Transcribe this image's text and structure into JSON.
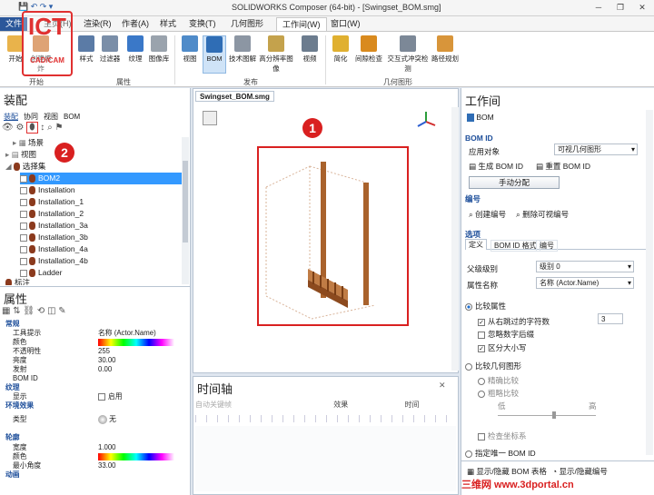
{
  "window": {
    "title": "SOLIDWORKS Composer (64-bit) - [Swingset_BOM.smg]"
  },
  "tabs": [
    "文件",
    "主页(H)",
    "渲染(R)",
    "作者(A)",
    "样式",
    "变换(T)",
    "几何图形",
    "工作间(W)",
    "窗口(W)"
  ],
  "ribbon": {
    "buttons": [
      "开始",
      "创建爆炸",
      "样式",
      "过滤器",
      "纹理",
      "图像库",
      "视图",
      "BOM",
      "技术图解",
      "高分辨率图像",
      "视频",
      "简化",
      "间隙检查",
      "交互式冲突检测",
      "路径规划"
    ],
    "groups": [
      "开始",
      "属性",
      "发布",
      "几何图形"
    ]
  },
  "watermark": {
    "line1": "ICT",
    "line2": "CAD/CAM"
  },
  "left_panel": {
    "title": "装配",
    "subtabs": [
      "装配",
      "协同",
      "视图",
      "BOM"
    ],
    "tree": [
      "场景",
      "视图",
      "选择集",
      "BOM2",
      "Installation",
      "Installation_1",
      "Installation_2",
      "Installation_3a",
      "Installation_3b",
      "Installation_4a",
      "Installation_4b",
      "Ladder",
      "标注"
    ]
  },
  "props": {
    "title": "属性",
    "sections": [
      "常规",
      "纹理",
      "环境效果",
      "轮廓"
    ],
    "rows": [
      {
        "k": "工具提示",
        "v": "名称 (Actor.Name)"
      },
      {
        "k": "颜色",
        "v": ""
      },
      {
        "k": "不透明性",
        "v": "255"
      },
      {
        "k": "亮度",
        "v": "30.00"
      },
      {
        "k": "发射",
        "v": "0.00"
      },
      {
        "k": "BOM ID",
        "v": ""
      },
      {
        "k": "显示",
        "v": "启用"
      },
      {
        "k": "类型",
        "v": "无"
      },
      {
        "k": "宽度",
        "v": "1.000"
      },
      {
        "k": "颜色",
        "v": ""
      },
      {
        "k": "最小角度",
        "v": "33.00"
      },
      {
        "k": "动画",
        "v": ""
      }
    ]
  },
  "viewport": {
    "tab": "Swingset_BOM.smg",
    "marker1": "1",
    "marker2": "2"
  },
  "timeline": {
    "title": "时间轴",
    "toolbar": [
      "自动关键帧",
      "效果",
      "时间"
    ]
  },
  "workspace": {
    "title": "工作间",
    "bom_label": "BOM",
    "bom_id_section": "BOM ID",
    "apply_to_label": "应用对象",
    "apply_to_value": "可视几何图形",
    "gen_bom_id": "生成 BOM ID",
    "reset_bom_id": "重置 BOM ID",
    "manual_assign": "手动分配",
    "numbering_section": "编号",
    "create_number": "创建编号",
    "delete_visible": "删除可视编号",
    "options_section": "选项",
    "option_tabs": [
      "定义",
      "BOM ID 格式",
      "编号"
    ],
    "parent_level_label": "父级级别",
    "parent_level_value": "级别 0",
    "attr_name_label": "属性名称",
    "attr_name_value": "名称 (Actor.Name)",
    "compare_attr": "比较属性",
    "skip_chars": "从右跳过的字符数",
    "skip_value": "3",
    "ignore_trailing": "忽略数字后缀",
    "case_sensitive": "区分大小写",
    "compare_geom": "比较几何图形",
    "exact": "精确比较",
    "rough": "粗略比较",
    "low": "低",
    "high": "高",
    "check_coords": "检查坐标系",
    "unique_id": "指定唯一 BOM ID",
    "show_bom_table": "显示/隐藏 BOM 表格",
    "show_numbers": "显示/隐藏编号",
    "site_watermark": "三维网 www.3dportal.cn"
  }
}
